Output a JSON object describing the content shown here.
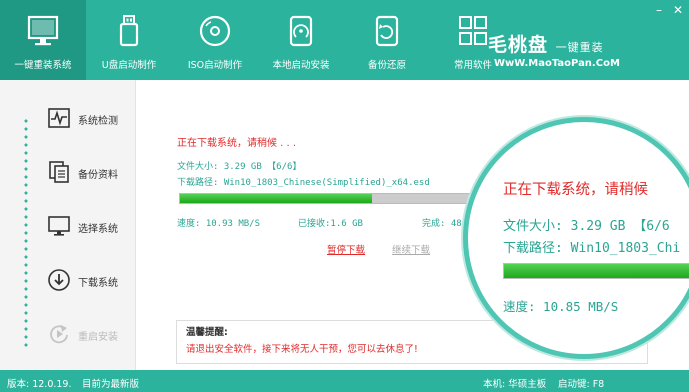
{
  "nav": {
    "items": [
      {
        "label": "一键重装系统",
        "icon": "monitor-icon"
      },
      {
        "label": "U盘启动制作",
        "icon": "usb-icon"
      },
      {
        "label": "ISO启动制作",
        "icon": "disc-icon"
      },
      {
        "label": "本地启动安装",
        "icon": "hdd-icon"
      },
      {
        "label": "备份还原",
        "icon": "backup-restore-icon"
      },
      {
        "label": "常用软件",
        "icon": "apps-grid-icon"
      }
    ]
  },
  "logo": {
    "main": "毛桃盘",
    "suffix": "一键重装",
    "url": "WwW.MaoTaoPan.CoM"
  },
  "window": {
    "minimize": "–",
    "close": "✕"
  },
  "sidebar": {
    "steps": [
      {
        "label": "系统检测",
        "icon": "pulse-icon"
      },
      {
        "label": "备份资料",
        "icon": "documents-icon"
      },
      {
        "label": "选择系统",
        "icon": "monitor-icon"
      },
      {
        "label": "下载系统",
        "icon": "download-icon"
      },
      {
        "label": "重启安装",
        "icon": "restart-icon"
      }
    ]
  },
  "download": {
    "status": "正在下载系统，请稍候 . . .",
    "size": "文件大小: 3.29 GB 【6/6】",
    "path": "下载路径: Win10_1803_Chinese(Simplified)_x64.esd",
    "progress": 0.64,
    "speed": "速度: 10.93 MB/S",
    "received": "已接收:1.6 GB",
    "done": "完成: 48",
    "pause_label": "暂停下载",
    "continue_label": "继续下载"
  },
  "tip": {
    "title": "温馨提醒:",
    "text": "请退出安全软件，接下来将无人干预，您可以去休息了!"
  },
  "magnifier": {
    "status": "正在下载系统，请稍候",
    "size": "文件大小: 3.29 GB 【6/6",
    "path": "下载路径: Win10_1803_Chi",
    "speed": "速度: 10.85 MB/S"
  },
  "footer": {
    "version": "版本: 12.0.19.",
    "latest": "目前为最新版",
    "machine": "本机: 华硕主板",
    "hotkey": "启动键: F8"
  },
  "colors": {
    "brand": "#2bb39d",
    "alert": "#e12b2b",
    "progress": "#1da81d"
  }
}
